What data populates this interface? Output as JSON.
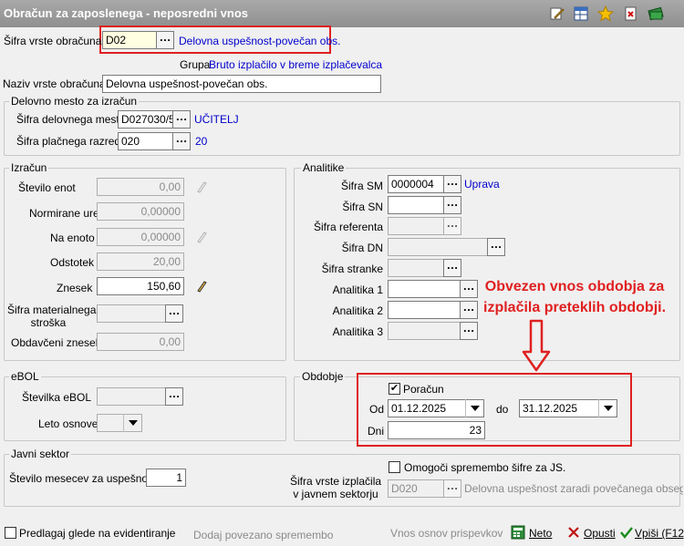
{
  "window": {
    "title": "Obračun za zaposlenega - neposredni vnos"
  },
  "toolbar_icons": [
    "edit-icon",
    "grid-icon",
    "star-icon",
    "delete-icon",
    "books-icon"
  ],
  "header": {
    "sifra_label": "Šifra vrste obračuna",
    "sifra_value": "D02",
    "sifra_desc": "Delovna uspešnost-povečan obs.",
    "grupa_label": "Grupa",
    "grupa_value": "Bruto izplačilo v breme izplačevalca",
    "naziv_label": "Naziv vrste obračuna",
    "naziv_value": "Delovna uspešnost-povečan obs."
  },
  "delovno_mesto": {
    "title": "Delovno mesto za izračun",
    "dm_label": "Šifra delovnega mesta",
    "dm_value": "D027030/5",
    "dm_desc": "UČITELJ",
    "pr_label": "Šifra plačnega razreda",
    "pr_value": "020",
    "pr_desc": "20"
  },
  "izracun": {
    "title": "Izračun",
    "enot_label": "Število enot",
    "enot_value": "0,00",
    "ure_label": "Normirane ure",
    "ure_value": "0,00000",
    "na_enoto_label": "Na enoto",
    "na_enoto_value": "0,00000",
    "odstotek_label": "Odstotek",
    "odstotek_value": "20,00",
    "znesek_label": "Znesek",
    "znesek_value": "150,60",
    "mat_label_1": "Šifra materialnega",
    "mat_label_2": "stroška",
    "obdav_label": "Obdavčeni znesek",
    "obdav_value": "0,00"
  },
  "analitike": {
    "title": "Analitike",
    "sm_label": "Šifra SM",
    "sm_value": "0000004",
    "sm_desc": "Uprava",
    "sn_label": "Šifra SN",
    "ref_label": "Šifra referenta",
    "dn_label": "Šifra DN",
    "stranka_label": "Šifra stranke",
    "a1_label": "Analitika 1",
    "a2_label": "Analitika 2",
    "a3_label": "Analitika 3"
  },
  "annotation": {
    "line1": "Obvezen vnos obdobja za",
    "line2": "izplačila preteklih obdobji.",
    "color": "#e02020"
  },
  "ebol": {
    "title": "eBOL",
    "st_label": "Številka eBOL",
    "leto_label": "Leto osnove"
  },
  "obdobje": {
    "title": "Obdobje",
    "poracun_label": "Poračun",
    "poracun_checked": "✔",
    "od_label": "Od",
    "od_value": "01.12.2025",
    "do_label": "do",
    "do_value": "31.12.2025",
    "dni_label": "Dni",
    "dni_value": "23"
  },
  "javni": {
    "title": "Javni sektor",
    "mesecev_label": "Število mesecev za uspešnost",
    "mesecev_value": "1",
    "omogoci_label": "Omogoči spremembo šifre za JS.",
    "vrsta_label_1": "Šifra vrste izplačila",
    "vrsta_label_2": "v javnem sektorju",
    "vrsta_value": "D020",
    "vrsta_desc": "Delovna uspešnost zaradi povečanega obsega del"
  },
  "footer": {
    "predlagaj_label": "Predlagaj glede na evidentiranje",
    "dodaj_label": "Dodaj povezano spremembo",
    "vnos_label": "Vnos osnov prispevkov",
    "neto_label": "Neto",
    "opusti_label": "Opusti",
    "vpisi_label": "Vpiši (F12)"
  }
}
